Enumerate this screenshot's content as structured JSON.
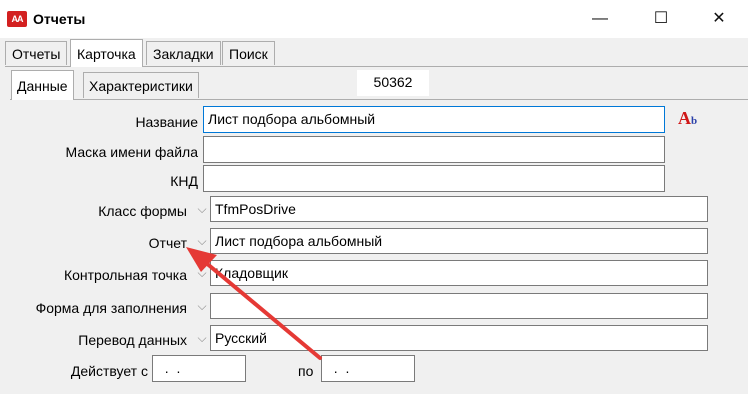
{
  "window": {
    "title": "Отчеты",
    "app_icon": "AA",
    "minimize": "—",
    "maximize": "☐",
    "close": "✕"
  },
  "tabs": [
    {
      "label": "Отчеты"
    },
    {
      "label": "Карточка"
    },
    {
      "label": "Закладки"
    },
    {
      "label": "Поиск"
    }
  ],
  "subtabs": [
    {
      "label": "Данные"
    },
    {
      "label": "Характеристики"
    }
  ],
  "record_id": "50362",
  "fields": {
    "name": {
      "label": "Название",
      "value": "Лист подбора альбомный"
    },
    "mask": {
      "label": "Маска имени файла",
      "value": ""
    },
    "knd": {
      "label": "КНД",
      "value": ""
    },
    "form_class": {
      "label": "Класс формы",
      "value": "TfmPosDrive"
    },
    "report": {
      "label": "Отчет",
      "value": "Лист подбора альбомный"
    },
    "control_point": {
      "label": "Контрольная точка",
      "value": "Кладовщик"
    },
    "fill_form": {
      "label": "Форма для заполнения",
      "value": ""
    },
    "data_translation": {
      "label": "Перевод данных",
      "value": "Русский"
    },
    "valid_from": {
      "label": "Действует с",
      "value": "  .  ."
    },
    "valid_to": {
      "label": "по",
      "value": "  .  ."
    }
  },
  "spellcheck_icon": {
    "big": "A",
    "small": "b"
  },
  "colors": {
    "arrow": "#e53935",
    "focus_border": "#0078d7"
  }
}
